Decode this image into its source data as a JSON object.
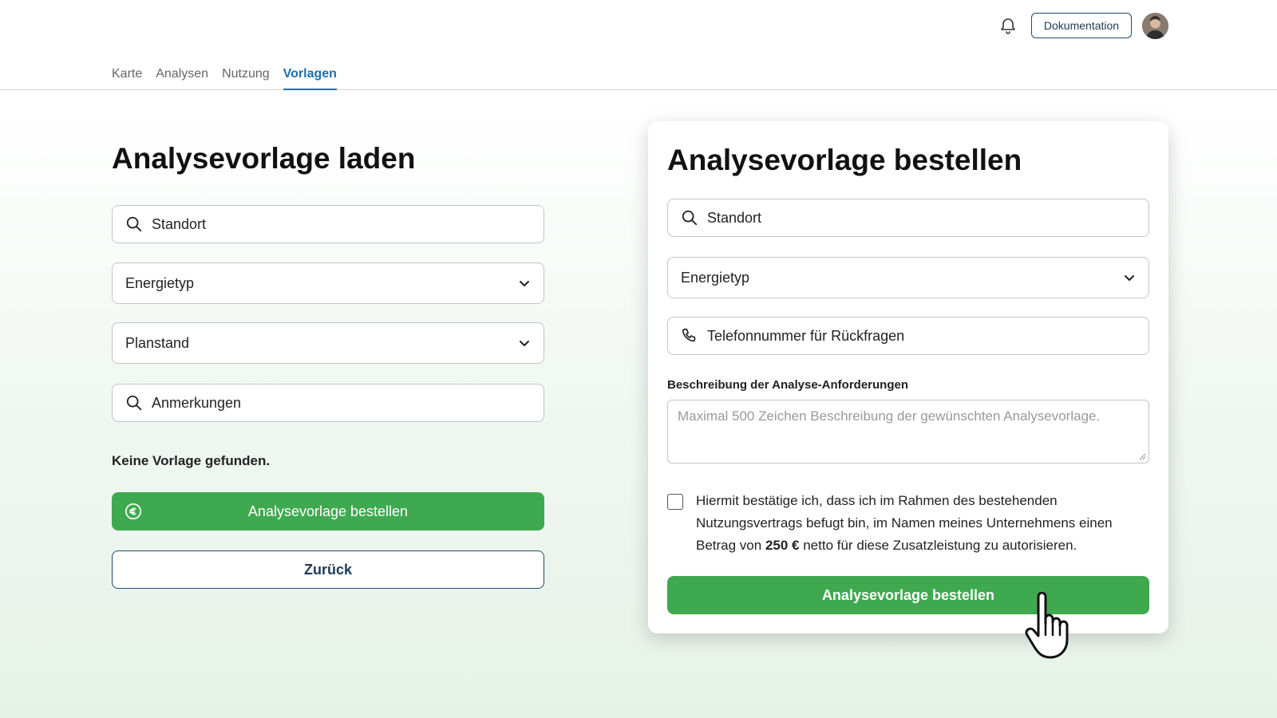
{
  "header": {
    "doc_button": "Dokumentation",
    "icons": {
      "notifications": "bell-icon",
      "avatar": "user-avatar"
    },
    "tabs": [
      {
        "label": "Karte",
        "active": false
      },
      {
        "label": "Analysen",
        "active": false
      },
      {
        "label": "Nutzung",
        "active": false
      },
      {
        "label": "Vorlagen",
        "active": true
      }
    ]
  },
  "load": {
    "title": "Analysevorlage laden",
    "location_placeholder": "Standort",
    "energy_type": "Energietyp",
    "plan_status": "Planstand",
    "remarks_placeholder": "Anmerkungen",
    "empty_message": "Keine Vorlage gefunden.",
    "order_button": "Analysevorlage bestellen",
    "back_button": "Zurück"
  },
  "order": {
    "title": "Analysevorlage bestellen",
    "location_placeholder": "Standort",
    "energy_type": "Energietyp",
    "phone_placeholder": "Telefonnummer für Rückfragen",
    "description_label": "Beschreibung der Analyse-Anforderungen",
    "description_placeholder": "Maximal 500 Zeichen Beschreibung der gewünschten Analysevorlage.",
    "consent_before": "Hiermit bestätige ich, dass ich im Rahmen des bestehenden Nutzungsvertrags befugt bin, im Namen meines Unternehmens einen Betrag von ",
    "consent_amount": "250 €",
    "consent_after": " netto für diese Zusatzleistung zu autorisieren.",
    "consent_checked": false,
    "submit_button": "Analysevorlage bestellen"
  },
  "colors": {
    "accent_green": "#3fa94f",
    "tab_active": "#1d6fa8",
    "outline": "#1d4a6b"
  }
}
